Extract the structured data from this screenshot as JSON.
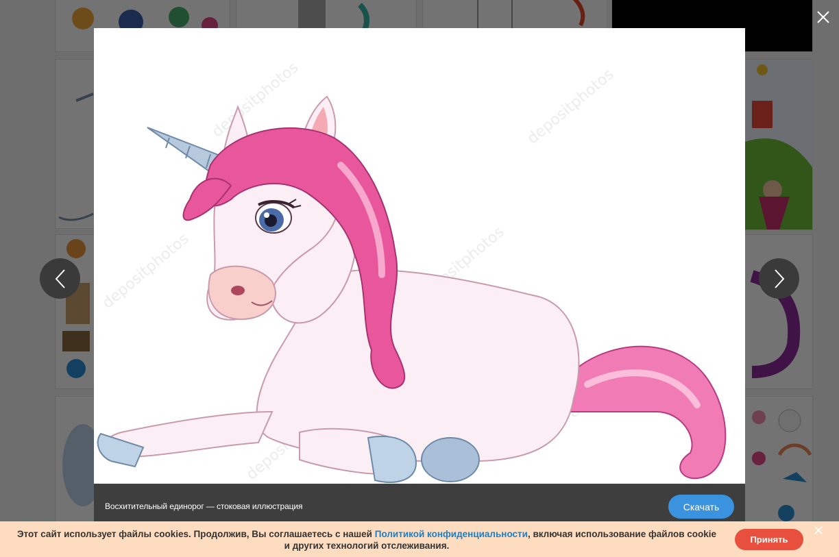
{
  "gallery": {
    "tiles": [
      "toys-thumb",
      "pony-thumb",
      "horse-sketch-thumb",
      "dark-thumb",
      "unicorn-thumb",
      "castle-princess-thumb",
      "animals-thumb",
      "purple-pony-thumb",
      "elephant-thumb",
      "stickers-thumb"
    ]
  },
  "lightbox": {
    "caption": "Восхитительный единорог — стоковая иллюстрация",
    "download_label": "Скачать",
    "watermark": "depositphotos"
  },
  "cookie": {
    "text_before": "Этот сайт использует файлы cookies. Продолжив, Вы соглашаетесь с нашей ",
    "link": "Политикой конфиденциальности",
    "text_after": ", включая использование файлов cookie и других технологий отслеживания.",
    "accept_label": "Принять"
  },
  "colors": {
    "download_btn": "#3b93e0",
    "accept_btn": "#e84f3d",
    "cookie_bg": "#fddcbf",
    "link": "#1a7fc9",
    "mane": "#e8579c"
  }
}
